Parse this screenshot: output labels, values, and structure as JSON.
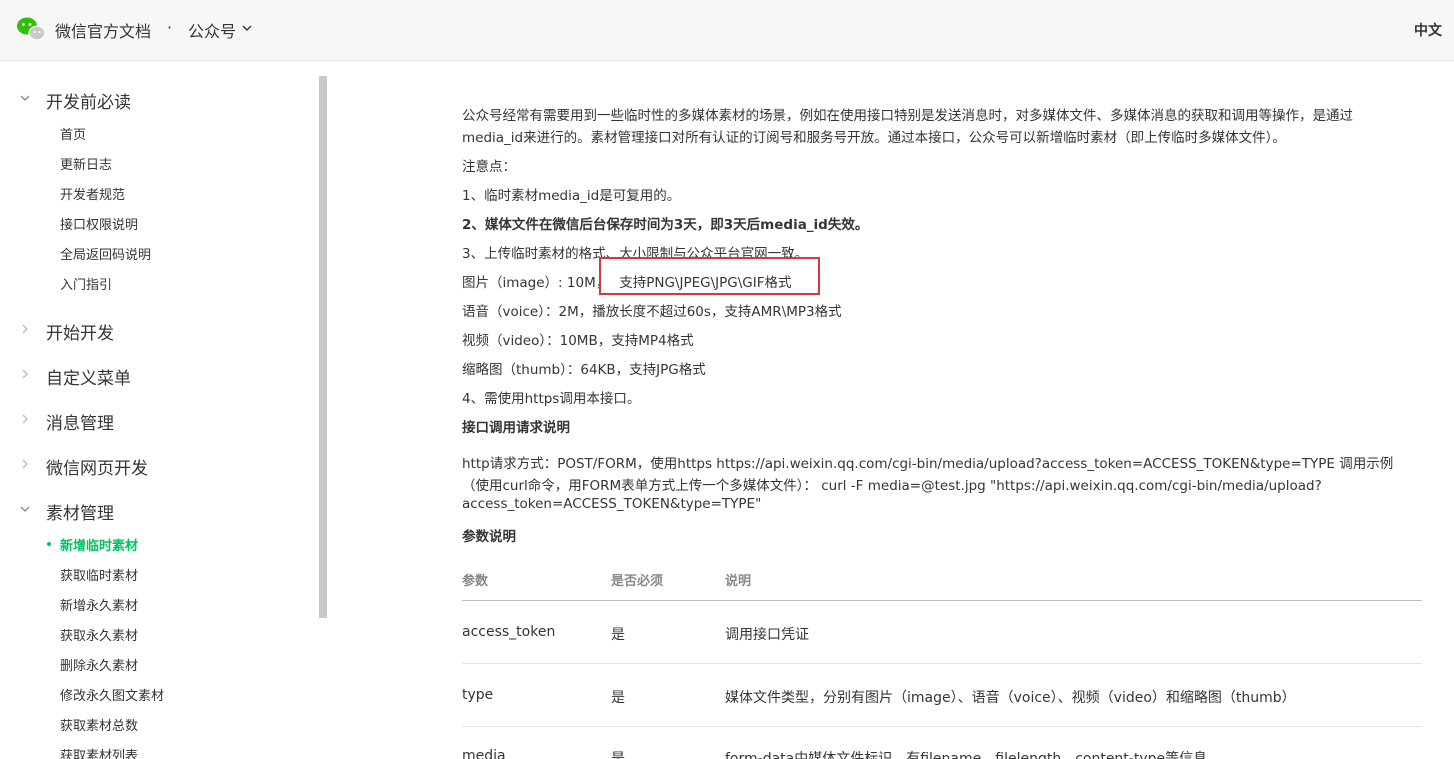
{
  "header": {
    "brand": "微信官方文档",
    "separator": "·",
    "product": "公众号",
    "lang": "中文"
  },
  "sidebar": {
    "groups": [
      {
        "label": "开发前必读",
        "expanded": true
      },
      {
        "label": "开始开发",
        "expanded": false
      },
      {
        "label": "自定义菜单",
        "expanded": false
      },
      {
        "label": "消息管理",
        "expanded": false
      },
      {
        "label": "微信网页开发",
        "expanded": false
      },
      {
        "label": "素材管理",
        "expanded": true
      }
    ],
    "group1_items": [
      "首页",
      "更新日志",
      "开发者规范",
      "接口权限说明",
      "全局返回码说明",
      "入门指引"
    ],
    "group6_items": [
      "新增临时素材",
      "获取临时素材",
      "新增永久素材",
      "获取永久素材",
      "删除永久素材",
      "修改永久图文素材",
      "获取素材总数",
      "获取素材列表"
    ],
    "active_item": "新增临时素材"
  },
  "main": {
    "intro_line1": "公众号经常有需要用到一些临时性的多媒体素材的场景，例如在使用接口特别是发送消息时，对多媒体文件、多媒体消息的获取和调用等操作，是通过",
    "intro_line2": "media_id来进行的。素材管理接口对所有认证的订阅号和服务号开放。通过本接口，公众号可以新增临时素材（即上传临时多媒体文件）。",
    "notes_title": "注意点：",
    "note1": "1、临时素材media_id是可复用的。",
    "note2": "2、媒体文件在微信后台保存时间为3天，即3天后media_id失效。",
    "note3": "3、上传临时素材的格式、大小限制与公众平台官网一致。",
    "image_line_prefix": "图片（image）: 10M，",
    "image_line_formats": "支持PNG\\JPEG\\JPG\\GIF格式",
    "voice_line": "语音（voice）：2M，播放长度不超过60s，支持AMR\\MP3格式",
    "video_line": "视频（video）：10MB，支持MP4格式",
    "thumb_line": "缩略图（thumb）：64KB，支持JPG格式",
    "note4": "4、需使用https调用本接口。",
    "request_title": "接口调用请求说明",
    "request_line1": "http请求方式：POST/FORM，使用https https://api.weixin.qq.com/cgi-bin/media/upload?access_token=ACCESS_TOKEN&type=TYPE 调用示例",
    "request_line2": "（使用curl命令，用FORM表单方式上传一个多媒体文件）： curl -F media=@test.jpg \"https://api.weixin.qq.com/cgi-bin/media/upload?",
    "request_line3": "access_token=ACCESS_TOKEN&type=TYPE\"",
    "params_title": "参数说明",
    "table": {
      "headers": [
        "参数",
        "是否必须",
        "说明"
      ],
      "rows": [
        [
          "access_token",
          "是",
          "调用接口凭证"
        ],
        [
          "type",
          "是",
          "媒体文件类型，分别有图片（image）、语音（voice）、视频（video）和缩略图（thumb）"
        ],
        [
          "media",
          "是",
          "form-data中媒体文件标识，有filename、filelength、content-type等信息"
        ]
      ]
    }
  },
  "colors": {
    "accent": "#07c160",
    "highlight_border": "#d33a3a"
  }
}
